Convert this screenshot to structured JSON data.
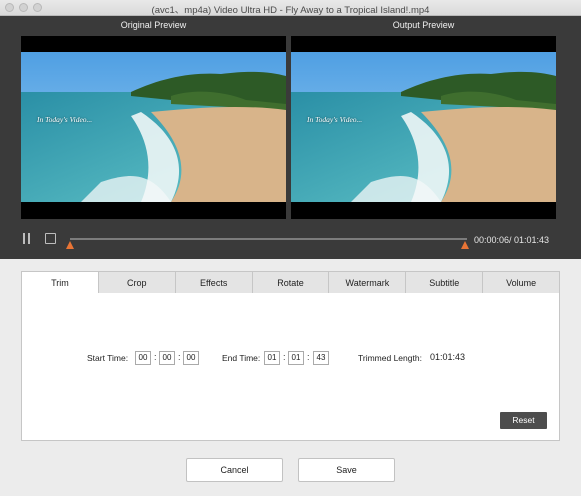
{
  "window": {
    "title": "(avc1、mp4a)   Video Ultra HD - Fly Away to a Tropical Island!.mp4"
  },
  "preview": {
    "original_label": "Original Preview",
    "output_label": "Output  Preview",
    "overlay_text": "In Today's Video..."
  },
  "playback": {
    "time_display": "00:00:06/ 01:01:43",
    "pause_icon": "pause-icon",
    "stop_icon": "stop-icon"
  },
  "tabs": [
    {
      "label": "Trim",
      "active": true
    },
    {
      "label": "Crop"
    },
    {
      "label": "Effects"
    },
    {
      "label": "Rotate"
    },
    {
      "label": "Watermark"
    },
    {
      "label": "Subtitle"
    },
    {
      "label": "Volume"
    }
  ],
  "trim": {
    "start_label": "Start Time:",
    "start": {
      "h": "00",
      "m": "00",
      "s": "00"
    },
    "end_label": "End Time:",
    "end": {
      "h": "01",
      "m": "01",
      "s": "43"
    },
    "trimmed_label": "Trimmed Length:",
    "trimmed_value": "01:01:43",
    "reset_label": "Reset"
  },
  "footer": {
    "cancel_label": "Cancel",
    "save_label": "Save"
  },
  "colors": {
    "accent_handle": "#e87435",
    "preview_bg": "#3a3a3a",
    "reset_bg": "#4d4d4d"
  }
}
